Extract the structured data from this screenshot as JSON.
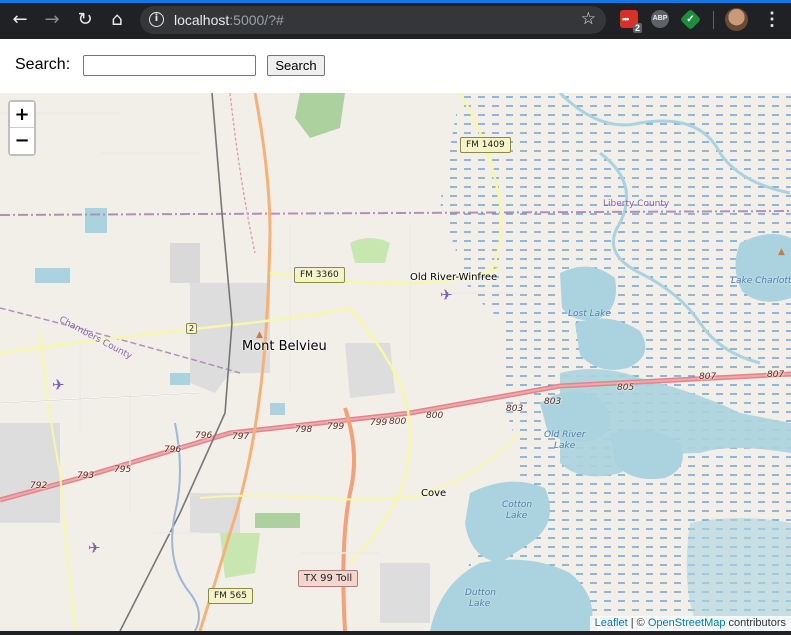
{
  "browser": {
    "url_host": "localhost",
    "url_rest": ":5000/?#",
    "extension_badge": "2",
    "abp_label": "ABP"
  },
  "search": {
    "label": "Search:",
    "input_value": "",
    "button_label": "Search"
  },
  "map": {
    "zoom_in_label": "+",
    "zoom_out_label": "−",
    "places": {
      "mont_belvieu": "Mont Belvieu",
      "old_river_winfree": "Old River-Winfree",
      "cove": "Cove"
    },
    "water": {
      "lost_lake": "Lost Lake",
      "old_river_lake_1": "Old River",
      "old_river_lake_2": "Lake",
      "cotton_lake_1": "Cotton",
      "cotton_lake_2": "Lake",
      "dutton_lake_1": "Dutton",
      "dutton_lake_2": "Lake",
      "lake_charlotte": "Lake Charlotte"
    },
    "counties": {
      "liberty": "Liberty County",
      "chambers": "Chambers County"
    },
    "shields": {
      "fm1409": "FM 1409",
      "fm3360": "FM 3360",
      "fm565": "FM 565",
      "tx99": "TX 99 Toll",
      "small": "2"
    },
    "road_numbers": [
      "792",
      "793",
      "795",
      "796",
      "796",
      "797",
      "798",
      "799",
      "799",
      "800",
      "800",
      "803",
      "803",
      "805",
      "807",
      "807"
    ]
  },
  "attribution": {
    "leaflet": "Leaflet",
    "separator": " | © ",
    "osm": "OpenStreetMap",
    "suffix": " contributors"
  }
}
